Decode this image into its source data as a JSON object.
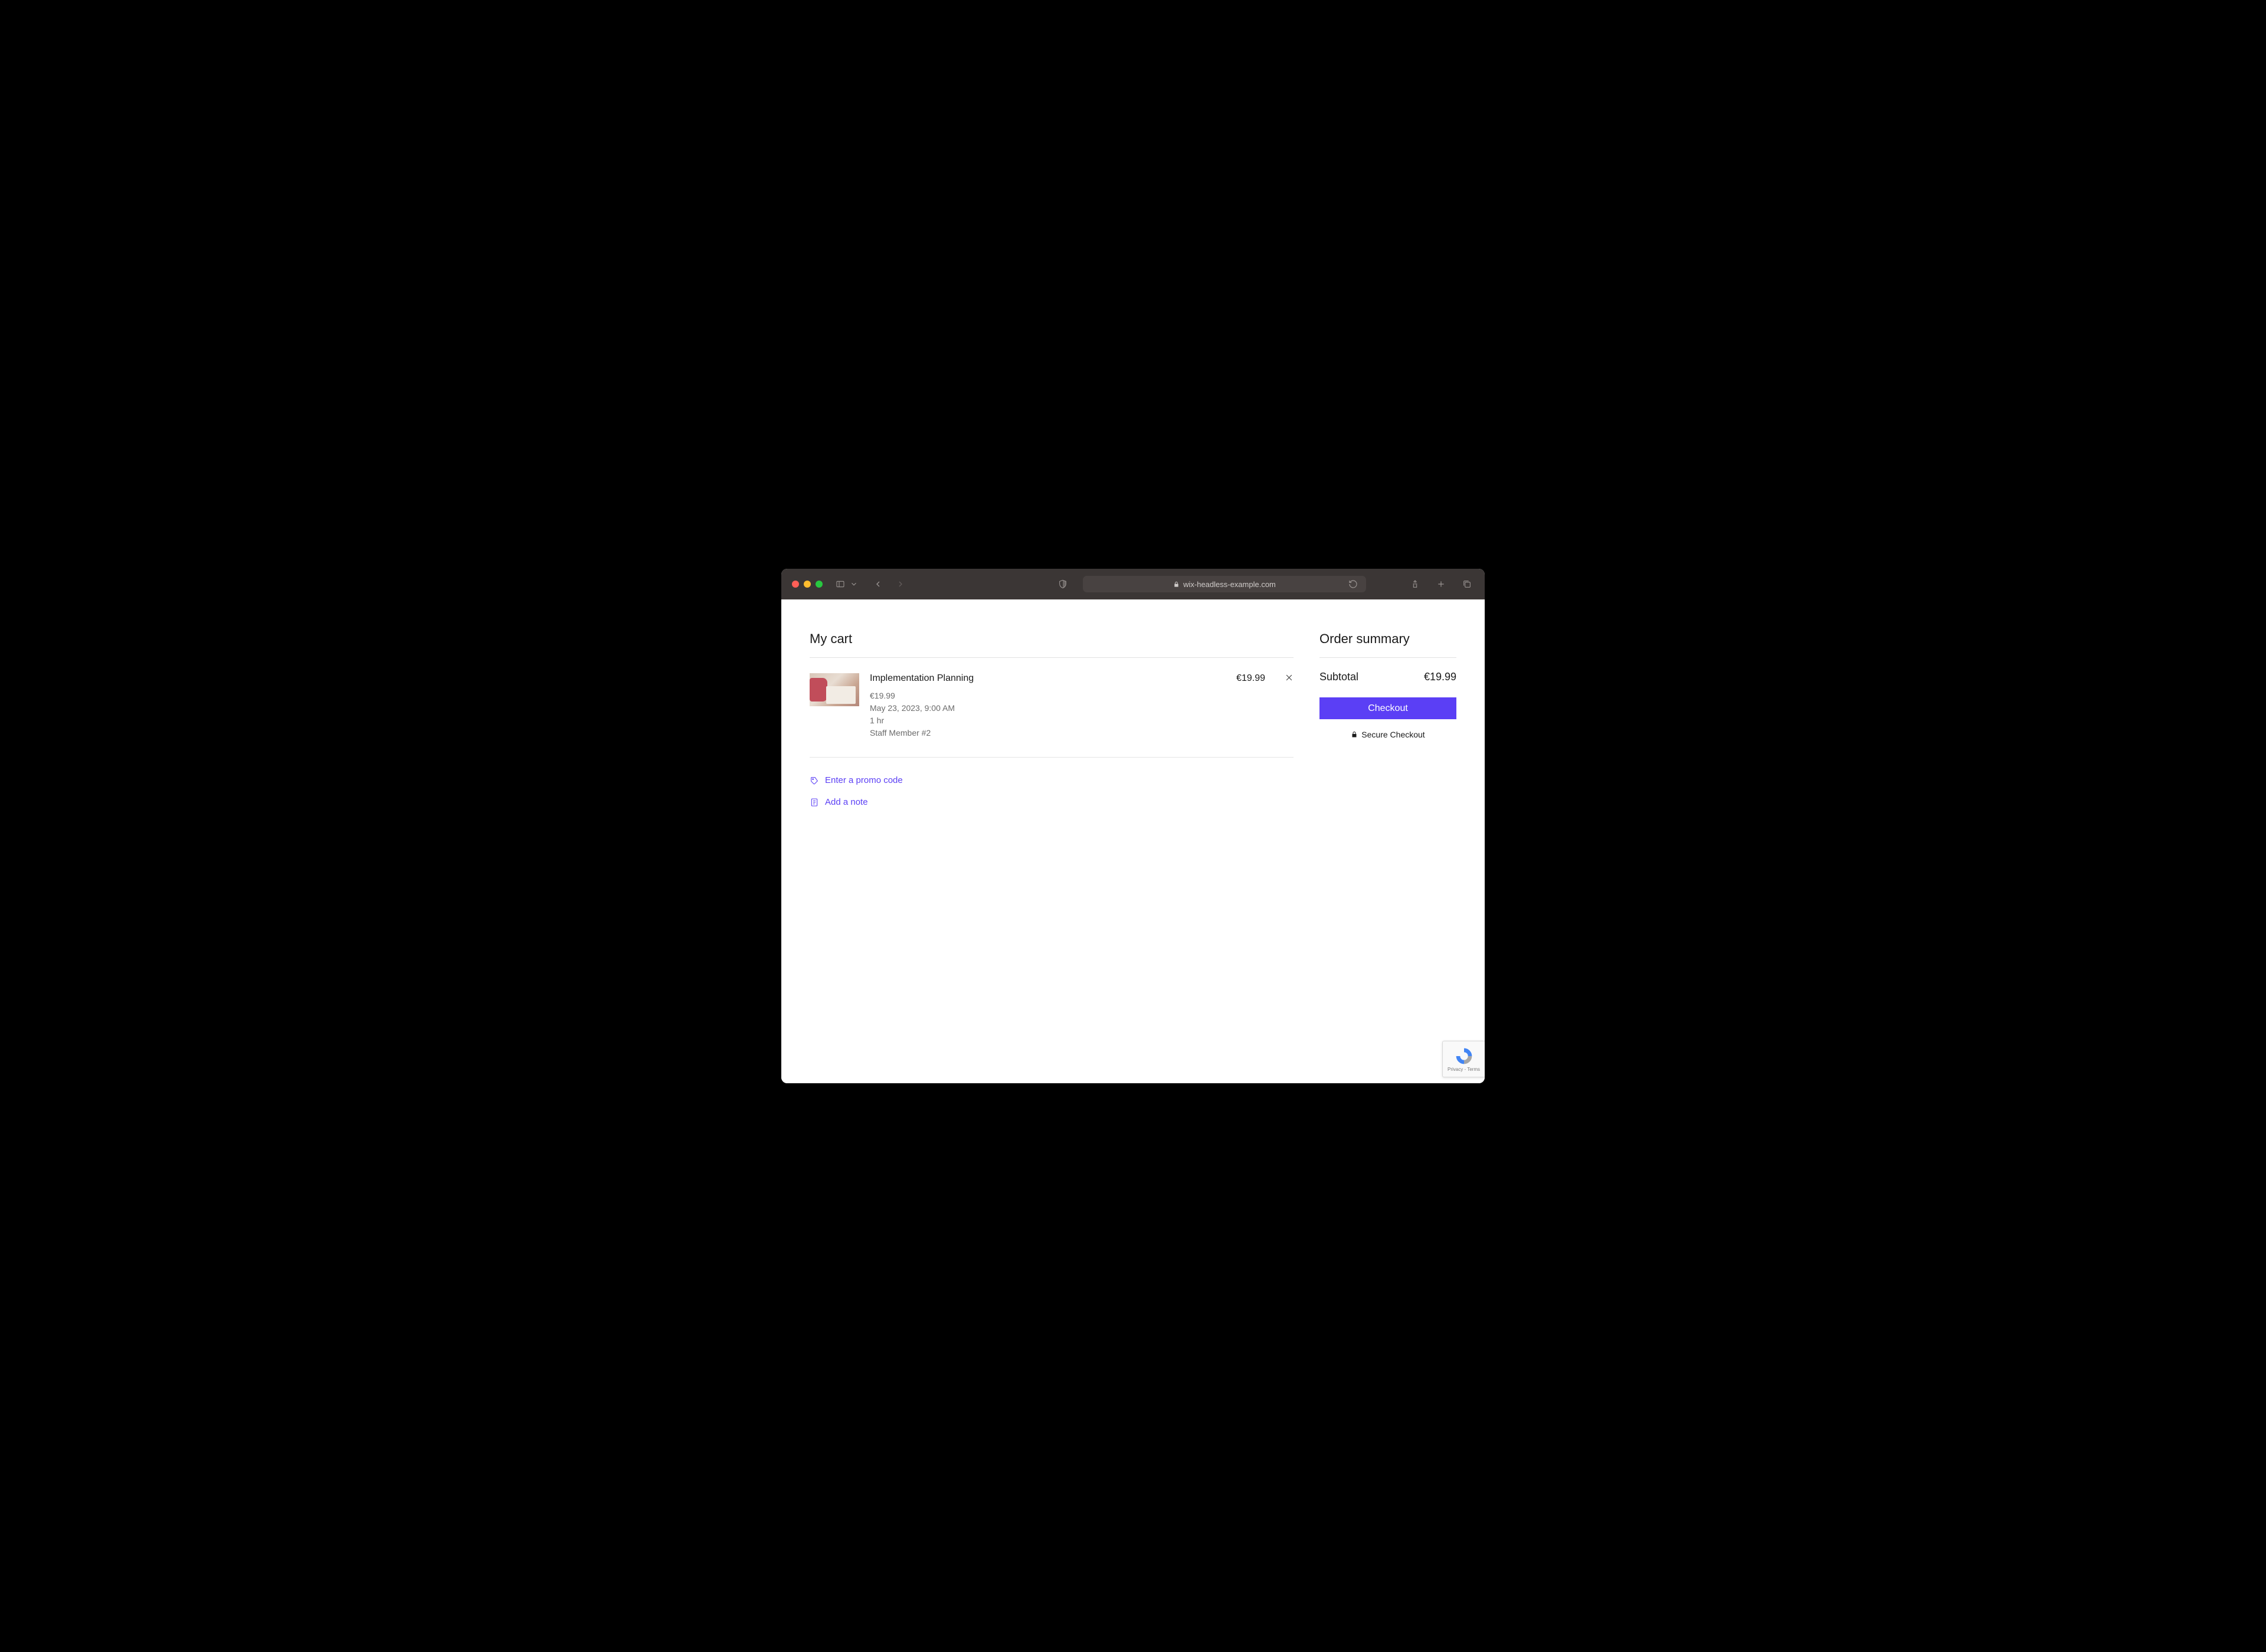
{
  "browser": {
    "url": "wix-headless-example.com"
  },
  "cart": {
    "title": "My cart",
    "items": [
      {
        "name": "Implementation Planning",
        "price": "€19.99",
        "unit_price": "€19.99",
        "datetime": "May 23, 2023, 9:00 AM",
        "duration": "1 hr",
        "staff": "Staff Member #2"
      }
    ],
    "promo_label": "Enter a promo code",
    "note_label": "Add a note"
  },
  "summary": {
    "title": "Order summary",
    "subtotal_label": "Subtotal",
    "subtotal_value": "€19.99",
    "checkout_label": "Checkout",
    "secure_label": "Secure Checkout"
  },
  "recaptcha": {
    "footer": "Privacy - Terms"
  }
}
